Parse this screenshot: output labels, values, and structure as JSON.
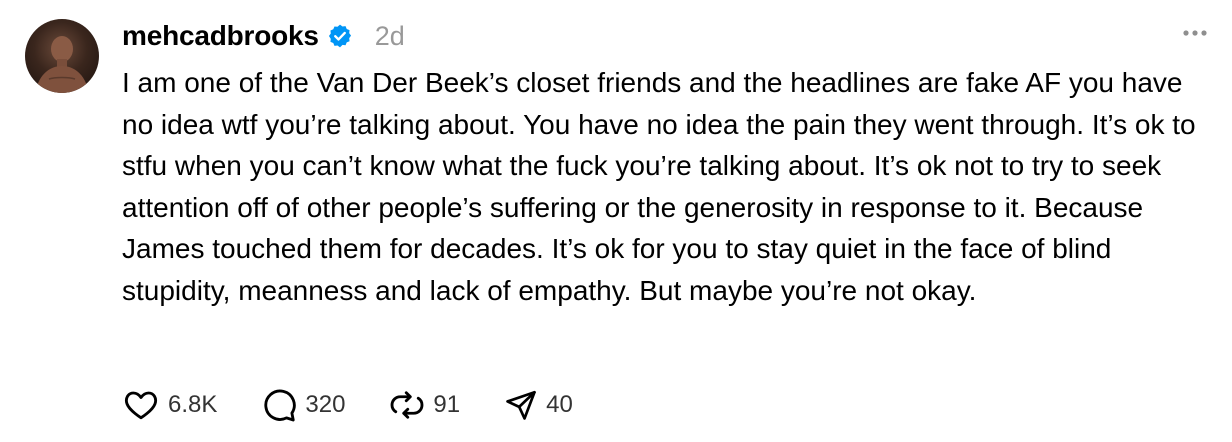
{
  "post": {
    "username": "mehcadbrooks",
    "timestamp": "2d",
    "text": "I am one of the Van Der Beek’s closet friends and the headlines are fake AF you have no idea wtf you’re talking about. You have no idea the pain they went through. It’s ok to stfu when you can’t know what the fuck you’re talking about. It’s ok not to try to seek attention off of other people’s suffering or the generosity in response to it. Because James touched them for decades. It’s ok for you to stay quiet in the face of blind stupidity, meanness and lack of empathy. But maybe you’re not okay."
  },
  "actions": {
    "likes": "6.8K",
    "comments": "320",
    "reposts": "91",
    "shares": "40"
  },
  "icons": {
    "verified": "verified-badge-icon",
    "more": "more-options-icon",
    "like": "heart-icon",
    "comment": "comment-bubble-icon",
    "repost": "repost-icon",
    "share": "send-icon"
  },
  "colors": {
    "verified_blue": "#0095F6",
    "timestamp_gray": "#999999",
    "icon_dark": "#000000"
  }
}
